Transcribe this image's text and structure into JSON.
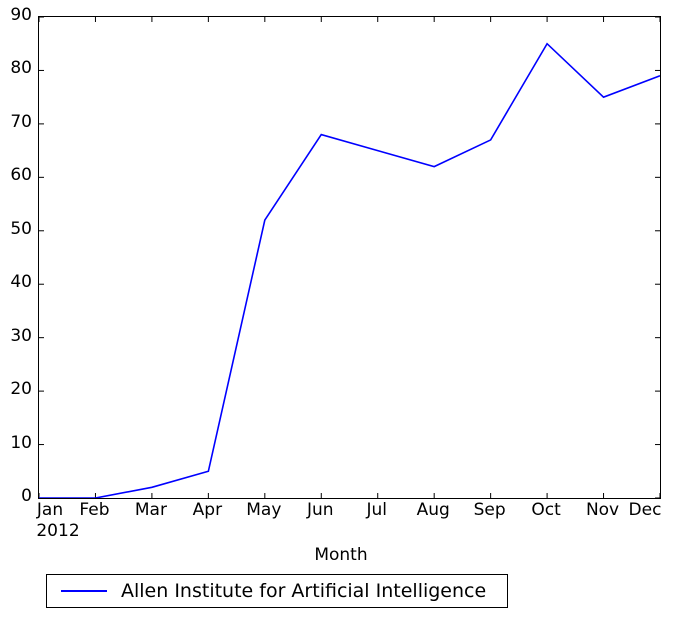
{
  "chart_data": {
    "type": "line",
    "title": "",
    "xlabel": "Month",
    "ylabel": "",
    "categories": [
      "Jan",
      "Feb",
      "Mar",
      "Apr",
      "May",
      "Jun",
      "Jul",
      "Aug",
      "Sep",
      "Oct",
      "Nov",
      "Dec"
    ],
    "x_sublabels": [
      "2012",
      "",
      "",
      "",
      "",
      "",
      "",
      "",
      "",
      "",
      "",
      ""
    ],
    "series": [
      {
        "name": "Allen Institute for Artificial Intelligence",
        "color": "#0000ff",
        "values": [
          0,
          0,
          2,
          5,
          52,
          68,
          65,
          62,
          67,
          85,
          75,
          79
        ]
      }
    ],
    "ylim": [
      0,
      90
    ],
    "yticks": [
      0,
      10,
      20,
      30,
      40,
      50,
      60,
      70,
      80,
      90
    ],
    "ytick_labels": [
      "0",
      "10",
      "20",
      "30",
      "40",
      "50",
      "60",
      "70",
      "80",
      "90"
    ],
    "xlim": [
      0,
      11
    ],
    "grid": false,
    "legend_position": "below-axes",
    "legend_entries": [
      "Allen Institute for Artificial Intelligence"
    ]
  },
  "axis": {
    "x_label": "Month"
  },
  "legend": {
    "items": [
      {
        "label": "Allen Institute for Artificial Intelligence",
        "color": "#0000ff"
      }
    ]
  }
}
